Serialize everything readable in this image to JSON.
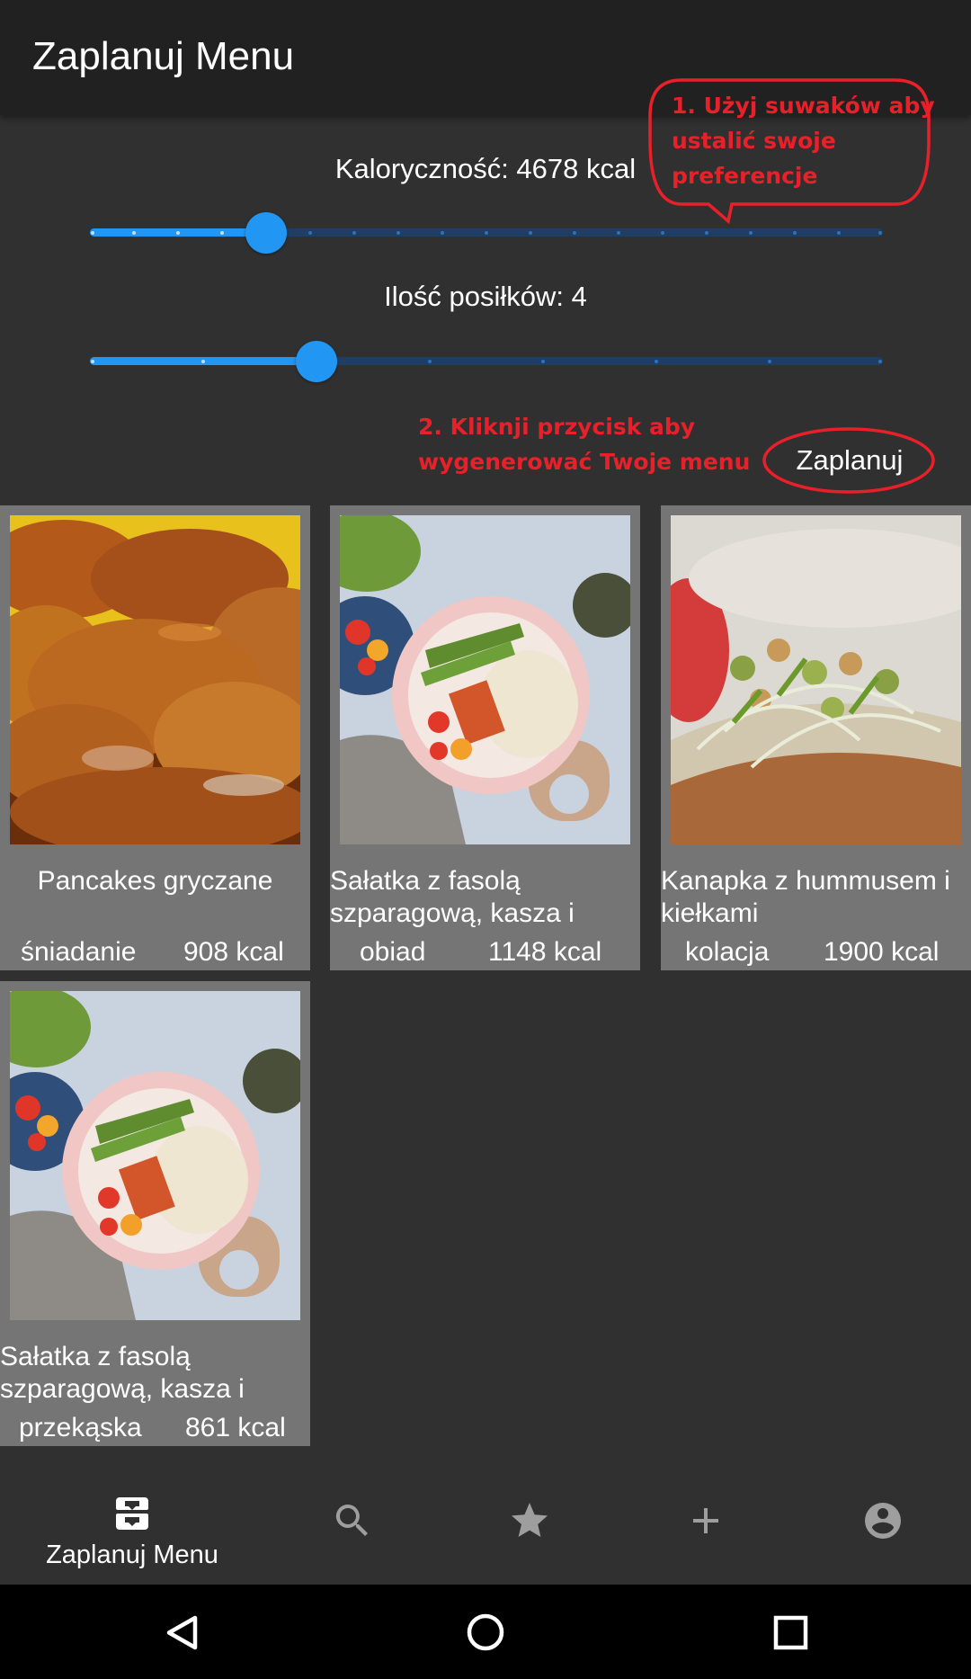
{
  "app_bar": {
    "title": "Zaplanuj Menu"
  },
  "calorie_slider": {
    "label": "Kaloryczność: 4678 kcal",
    "position": 0.222,
    "steps": 18
  },
  "meals_slider": {
    "label": "Ilość posiłków: 4",
    "position": 0.286,
    "steps": 7
  },
  "annotations": {
    "step1": [
      "1. Użyj suwaków aby",
      "ustalić swoje",
      "preferencje"
    ],
    "step2": [
      "2. Kliknji przycisk aby",
      "wygenerować Twoje menu"
    ],
    "color": "#e8202a"
  },
  "plan_button": {
    "label": "Zaplanuj"
  },
  "meals": [
    {
      "name": "Pancakes gryczane",
      "meal_type": "śniadanie",
      "calories": "908 kcal",
      "image": "pancakes-photo"
    },
    {
      "name": "Sałatka z fasolą szparagową, kasza i",
      "meal_type": "obiad",
      "calories": "1148 kcal",
      "image": "salad-bowl-photo"
    },
    {
      "name": "Kanapka z hummusem i kiełkami",
      "meal_type": "kolacja",
      "calories": "1900 kcal",
      "image": "sandwich-sprouts-photo"
    },
    {
      "name": "Sałatka z fasolą szparagową, kasza i",
      "meal_type": "przekąska",
      "calories": "861 kcal",
      "image": "salad-bowl-photo"
    }
  ],
  "bottom_nav": {
    "items": [
      {
        "label": "Zaplanuj Menu",
        "icon": "plan-menu-icon",
        "active": true
      },
      {
        "icon": "search-icon"
      },
      {
        "icon": "star-icon"
      },
      {
        "icon": "add-icon"
      },
      {
        "icon": "account-icon"
      }
    ]
  },
  "system_nav": {
    "buttons": [
      "back-icon",
      "home-icon",
      "recents-icon"
    ]
  },
  "colors": {
    "accent": "#2196f3",
    "app_bar": "#212121",
    "background": "#303030",
    "card": "#757575",
    "inactive_icon": "#9e9e9e"
  }
}
